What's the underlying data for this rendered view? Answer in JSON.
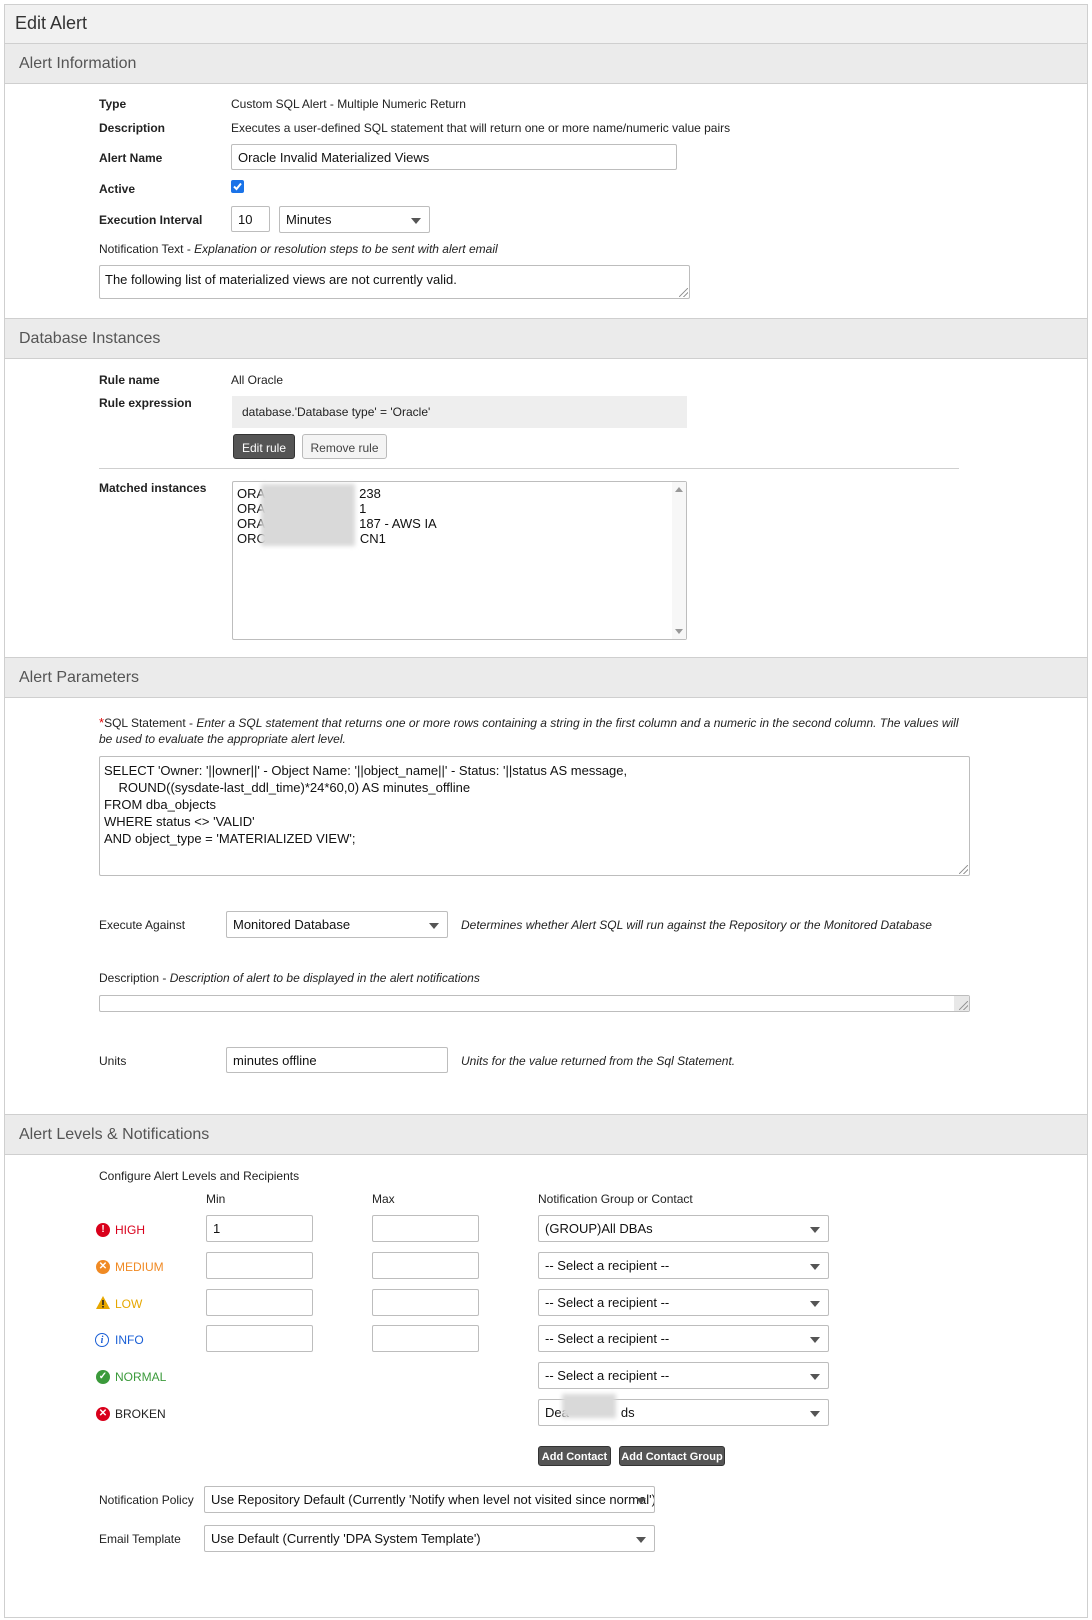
{
  "page": {
    "title": "Edit Alert"
  },
  "sections": {
    "alert_info": "Alert Information",
    "db_instances": "Database Instances",
    "alert_params": "Alert Parameters",
    "alert_levels": "Alert Levels & Notifications"
  },
  "alert_info": {
    "type_label": "Type",
    "type_value": "Custom SQL Alert - Multiple Numeric Return",
    "description_label": "Description",
    "description_value": "Executes a user-defined SQL statement that will return one or more name/numeric value pairs",
    "alert_name_label": "Alert Name",
    "alert_name_value": "Oracle Invalid Materialized Views",
    "active_label": "Active",
    "active_checked": true,
    "interval_label": "Execution Interval",
    "interval_value": "10",
    "interval_unit": "Minutes",
    "notification_text_label": "Notification Text - ",
    "notification_text_hint": "Explanation or resolution steps to be sent with alert email",
    "notification_text_value": "The following list of materialized views are not currently valid."
  },
  "db_instances": {
    "rule_name_label": "Rule name",
    "rule_name_value": "All Oracle",
    "rule_expr_label": "Rule expression",
    "rule_expr_value": "database.'Database type' = 'Oracle'",
    "edit_rule": "Edit rule",
    "remove_rule": "Remove rule",
    "matched_label": "Matched instances",
    "matched": [
      {
        "prefix": "ORA",
        "suffix": "238"
      },
      {
        "prefix": "ORA",
        "suffix": "1"
      },
      {
        "prefix": "ORA",
        "suffix": "187 - AWS IA"
      },
      {
        "prefix": "ORC",
        "suffix": "CN1"
      }
    ]
  },
  "alert_params": {
    "required_mark": "*",
    "sql_label": "SQL Statement - ",
    "sql_hint": "Enter a SQL statement that returns one or more rows containing a string in the first column and a numeric in the second column. The values will be used to evaluate the appropriate alert level.",
    "sql_lines": [
      "SELECT 'Owner: '||owner||' - Object Name: '||object_name||' - Status: '||status AS message,",
      "    ROUND((sysdate-last_ddl_time)*24*60,0) AS minutes_offline",
      "FROM dba_objects",
      "WHERE status <> 'VALID'",
      "AND object_type = 'MATERIALIZED VIEW';"
    ],
    "execute_against_label": "Execute Against",
    "execute_against_value": "Monitored Database",
    "execute_against_hint": "Determines whether Alert SQL will run against the Repository or the Monitored Database",
    "description_label": "Description - ",
    "description_hint": "Description of alert to be displayed in the alert notifications",
    "description_value": "",
    "units_label": "Units",
    "units_value": "minutes offline",
    "units_hint": "Units for the value returned from the Sql Statement."
  },
  "alert_levels": {
    "configure_label": "Configure Alert Levels and Recipients",
    "min_header": "Min",
    "max_header": "Max",
    "group_header": "Notification Group or Contact",
    "levels": [
      {
        "name": "HIGH",
        "color": "#d9001b",
        "icon": "exclamation-icon",
        "min": "1",
        "max": "",
        "recipient": "(GROUP)All DBAs",
        "has_range": true
      },
      {
        "name": "MEDIUM",
        "color": "#f08a24",
        "icon": "x-circle-icon",
        "min": "",
        "max": "",
        "recipient": "-- Select a recipient --",
        "has_range": true
      },
      {
        "name": "LOW",
        "color": "#e6a700",
        "icon": "warning-icon",
        "min": "",
        "max": "",
        "recipient": "-- Select a recipient --",
        "has_range": true
      },
      {
        "name": "INFO",
        "color": "#1a5fd6",
        "icon": "info-icon",
        "min": "",
        "max": "",
        "recipient": "-- Select a recipient --",
        "has_range": true
      },
      {
        "name": "NORMAL",
        "color": "#3b9a3b",
        "icon": "check-icon",
        "min": "",
        "max": "",
        "recipient": "-- Select a recipient --",
        "has_range": false
      },
      {
        "name": "BROKEN",
        "color": "#222222",
        "icon": "broken-icon",
        "min": "",
        "max": "",
        "recipient": "Dea",
        "recipient_suffix": "ds",
        "has_range": false
      }
    ],
    "add_contact": "Add Contact",
    "add_contact_group": "Add Contact Group",
    "policy_label": "Notification Policy",
    "policy_value": "Use Repository Default (Currently 'Notify when level not visited since normal')",
    "template_label": "Email Template",
    "template_value": "Use Default (Currently 'DPA System Template')"
  }
}
